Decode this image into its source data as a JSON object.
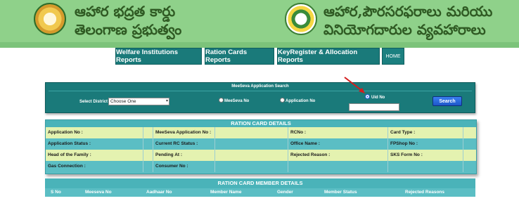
{
  "header": {
    "line1_left": "ఆహార భద్రత కార్డు",
    "line2_left": "తెలంగాణ ప్రభుత్వం",
    "line1_right": "ఆహార,పౌరసరఫరాలు మరియు",
    "line2_right": "వినియోగదారుల వ్యవహారాలు",
    "emblem_left": "telangana-emblem-icon",
    "emblem_right": "civil-supplies-logo-icon"
  },
  "nav": {
    "items": [
      "Welfare Institutions Reports",
      "Ration Cards Reports",
      "KeyRegister & Allocation Reports",
      "HOME"
    ]
  },
  "search": {
    "title": "MeeSeva Application Search",
    "district_label": "Select District :",
    "district_value": "Choose One",
    "options": [
      "MeeSeva No",
      "Application No",
      "Uid No"
    ],
    "selected_option": "Uid No",
    "uid_value": "",
    "button_label": "Search"
  },
  "ration_card": {
    "title": "RATION CARD DETAILS",
    "rows": [
      [
        "Application No :",
        "MeeSeva Application No :",
        "RCNo :",
        "Card Type :"
      ],
      [
        "Application Status :",
        "Current RC Status :",
        "Office Name :",
        "FPShop No :"
      ],
      [
        "Head of the Family :",
        "Pending At :",
        "Rejected Reason :",
        "SKS Form No :"
      ],
      [
        "Gas Connection :",
        "Consumer No :",
        "",
        ""
      ]
    ]
  },
  "member_details": {
    "title": "RATION CARD MEMBER DETAILS",
    "columns": [
      "S No",
      "Meeseva No",
      "Aadhaar No",
      "Member Name",
      "Gender",
      "Member Status",
      "Rejected Reasons"
    ]
  },
  "colors": {
    "header_bg": "#8fd18a",
    "teal": "#1a7a7a",
    "light_teal": "#5bbec4",
    "row_yellow": "#e4f2b0",
    "search_button": "#2a6ae0",
    "arrow": "#d41d1d"
  }
}
